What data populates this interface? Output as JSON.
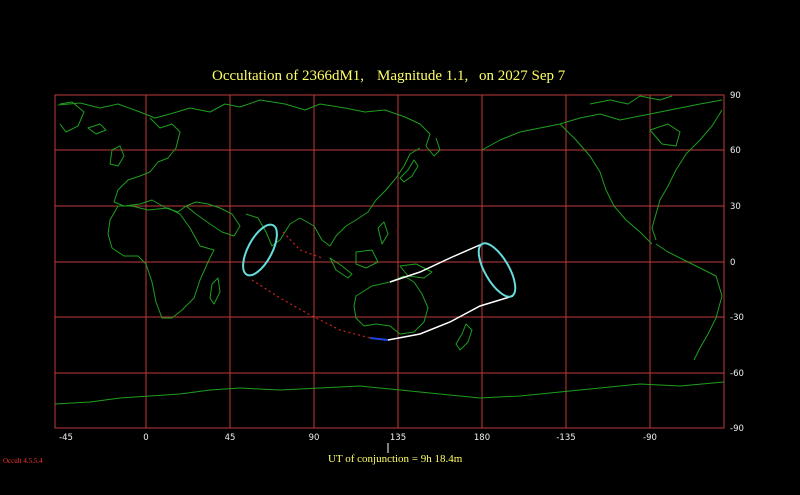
{
  "title": {
    "occultation": "Occultation of 2366dM1,",
    "magnitude": "Magnitude 1.1,",
    "date": "on 2027 Sep 7"
  },
  "footer": {
    "conjunction": "UT of conjunction = 9h 18.4m",
    "version": "Occult 4.5.5.4"
  },
  "axes": {
    "lon_ticks": [
      "-45",
      "0",
      "45",
      "90",
      "135",
      "180",
      "-135",
      "-90"
    ],
    "lat_ticks": [
      "90",
      "60",
      "30",
      "0",
      "-30",
      "-60",
      "-90"
    ]
  },
  "colors": {
    "background": "#000000",
    "grid": "#c03a3a",
    "coast": "#1f9e1f",
    "title": "#ffff66",
    "shadow_edge": "#ffffff",
    "shadow_end": "#66dddd",
    "track_daylight": "#cc2222",
    "track_twilight": "#2244dd"
  }
}
